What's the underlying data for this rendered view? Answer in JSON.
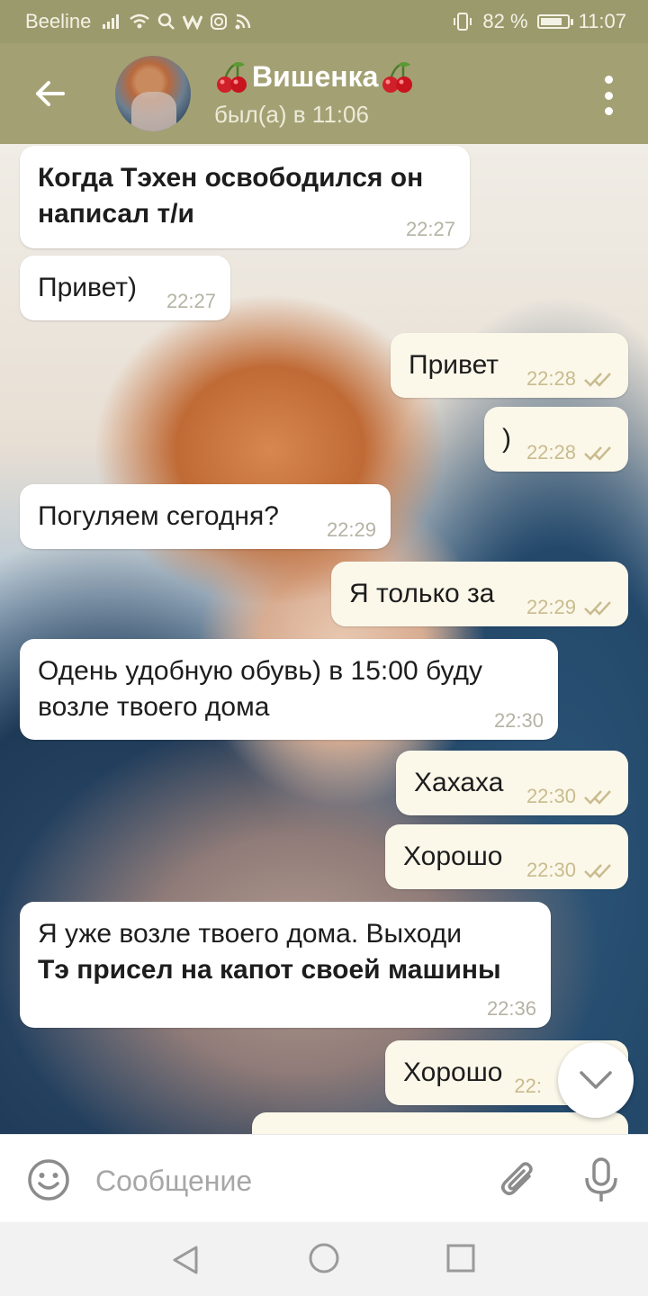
{
  "status_bar": {
    "carrier": "Beeline",
    "battery": "82 %",
    "battery_level": 0.82,
    "time": "11:07"
  },
  "header": {
    "title": "Вишенка",
    "status": "был(а) в 11:06",
    "icons": [
      "back-arrow-icon",
      "cherry-icon",
      "more-vert-icon"
    ]
  },
  "messages": [
    {
      "dir": "in",
      "text": "Когда Тэхен освободился он написал т/и",
      "bold": true,
      "time": "22:27"
    },
    {
      "dir": "in",
      "text": "Привет)",
      "time": "22:27"
    },
    {
      "dir": "out",
      "text": "Привет",
      "time": "22:28",
      "read": true
    },
    {
      "dir": "out",
      "text": ")",
      "time": "22:28",
      "read": true
    },
    {
      "dir": "in",
      "text": "Погуляем сегодня?",
      "time": "22:29"
    },
    {
      "dir": "out",
      "text": "Я только за",
      "time": "22:29",
      "read": true
    },
    {
      "dir": "in",
      "text": "Одень удобную обувь) в 15:00 буду возле твоего дома",
      "time": "22:30"
    },
    {
      "dir": "out",
      "text": "Хахаха",
      "time": "22:30",
      "read": true
    },
    {
      "dir": "out",
      "text": "Хорошо",
      "time": "22:30",
      "read": true
    },
    {
      "dir": "in",
      "text": "Я уже возле твоего дома. Выходи",
      "text2": "Тэ присел на капот своей машины",
      "time": "22:36"
    },
    {
      "dir": "out",
      "text": "Хорошо",
      "time": "22:",
      "read": true
    }
  ],
  "input": {
    "placeholder": "Сообщение",
    "value": ""
  },
  "colors": {
    "header_bg": "#a3a173",
    "status_bg": "#9b9a6c",
    "incoming_bubble": "#ffffff",
    "outgoing_bubble": "#fbf8ea",
    "read_check": "#c9bb8e"
  }
}
